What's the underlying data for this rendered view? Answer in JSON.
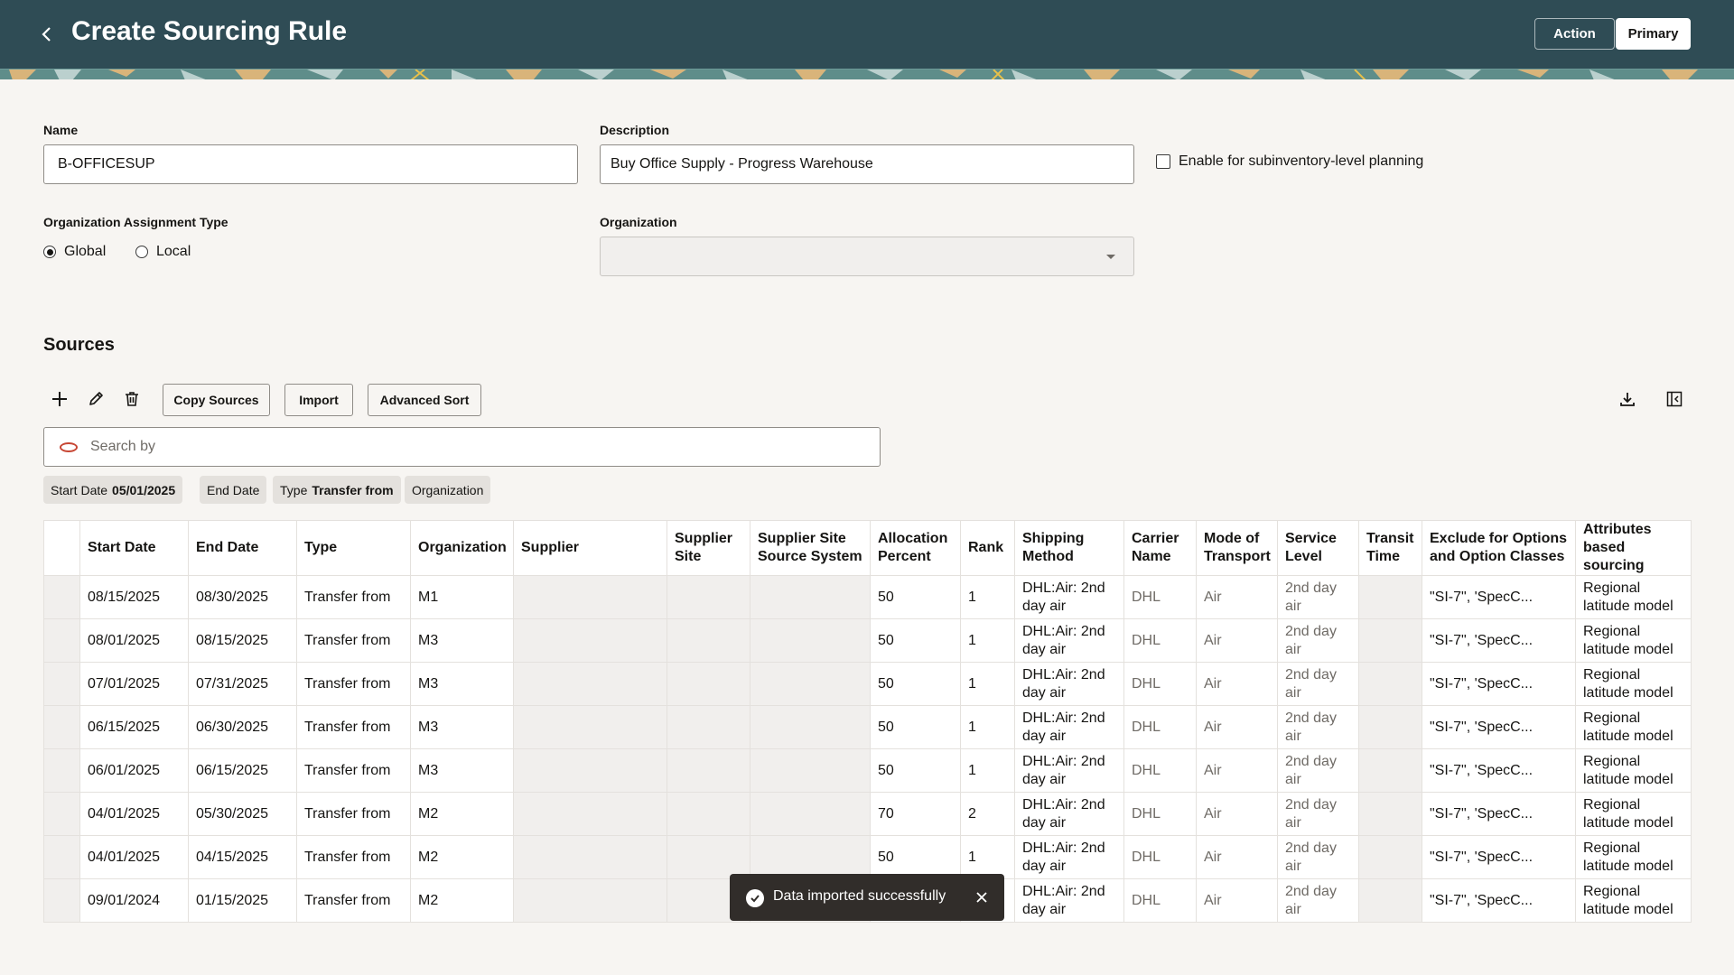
{
  "header": {
    "title": "Create Sourcing Rule",
    "action_label": "Action",
    "primary_label": "Primary"
  },
  "form": {
    "name_label": "Name",
    "name_value": "B-OFFICESUP",
    "description_label": "Description",
    "description_value": "Buy Office Supply - Progress Warehouse",
    "subinventory_checkbox_label": "Enable for subinventory-level planning",
    "subinventory_checked": false,
    "org_assignment_label": "Organization Assignment Type",
    "radio_global": "Global",
    "radio_local": "Local",
    "radio_selected": "Global",
    "organization_label": "Organization",
    "organization_value": ""
  },
  "sources": {
    "title": "Sources",
    "copy_sources_label": "Copy Sources",
    "import_label": "Import",
    "advanced_sort_label": "Advanced Sort",
    "search_placeholder": "Search by",
    "chips": [
      {
        "label": "Start Date",
        "value": "05/01/2025"
      },
      {
        "label": "End Date",
        "value": ""
      },
      {
        "label": "Type",
        "value": "Transfer from"
      },
      {
        "label": "Organization",
        "value": ""
      }
    ],
    "columns": [
      "Start Date",
      "End Date",
      "Type",
      "Organization",
      "Supplier",
      "Supplier Site",
      "Supplier Site Source System",
      "Allocation Percent",
      "Rank",
      "Shipping Method",
      "Carrier Name",
      "Mode of Transport",
      "Service Level",
      "Transit Time",
      "Exclude for Options and Option Classes",
      "Attributes based sourcing"
    ],
    "rows": [
      [
        "08/15/2025",
        "08/30/2025",
        "Transfer from",
        "M1",
        "",
        "",
        "",
        "50",
        "1",
        "DHL:Air: 2nd day air",
        "DHL",
        "Air",
        "2nd day air",
        "",
        "\"SI-7\", 'SpecC...",
        "Regional latitude model"
      ],
      [
        "08/01/2025",
        "08/15/2025",
        "Transfer from",
        "M3",
        "",
        "",
        "",
        "50",
        "1",
        "DHL:Air: 2nd day air",
        "DHL",
        "Air",
        "2nd day air",
        "",
        "\"SI-7\", 'SpecC...",
        "Regional latitude model"
      ],
      [
        "07/01/2025",
        "07/31/2025",
        "Transfer from",
        "M3",
        "",
        "",
        "",
        "50",
        "1",
        "DHL:Air: 2nd day air",
        "DHL",
        "Air",
        "2nd day air",
        "",
        "\"SI-7\", 'SpecC...",
        "Regional latitude model"
      ],
      [
        "06/15/2025",
        "06/30/2025",
        "Transfer from",
        "M3",
        "",
        "",
        "",
        "50",
        "1",
        "DHL:Air: 2nd day air",
        "DHL",
        "Air",
        "2nd day air",
        "",
        "\"SI-7\", 'SpecC...",
        "Regional latitude model"
      ],
      [
        "06/01/2025",
        "06/15/2025",
        "Transfer from",
        "M3",
        "",
        "",
        "",
        "50",
        "1",
        "DHL:Air: 2nd day air",
        "DHL",
        "Air",
        "2nd day air",
        "",
        "\"SI-7\", 'SpecC...",
        "Regional latitude model"
      ],
      [
        "04/01/2025",
        "05/30/2025",
        "Transfer from",
        "M2",
        "",
        "",
        "",
        "70",
        "2",
        "DHL:Air: 2nd day air",
        "DHL",
        "Air",
        "2nd day air",
        "",
        "\"SI-7\", 'SpecC...",
        "Regional latitude model"
      ],
      [
        "04/01/2025",
        "04/15/2025",
        "Transfer from",
        "M2",
        "",
        "",
        "",
        "50",
        "1",
        "DHL:Air: 2nd day air",
        "DHL",
        "Air",
        "2nd day air",
        "",
        "\"SI-7\", 'SpecC...",
        "Regional latitude model"
      ],
      [
        "09/01/2024",
        "01/15/2025",
        "Transfer from",
        "M2",
        "",
        "",
        "",
        "",
        "",
        "DHL:Air: 2nd day air",
        "DHL",
        "Air",
        "2nd day air",
        "",
        "\"SI-7\", 'SpecC...",
        "Regional latitude model"
      ]
    ]
  },
  "toast": {
    "message": "Data imported successfully"
  },
  "colors": {
    "header_bg": "#2f4c55",
    "page_bg": "#f7f5f2",
    "toast_bg": "#312d2a",
    "search_accent": "#c74634"
  }
}
